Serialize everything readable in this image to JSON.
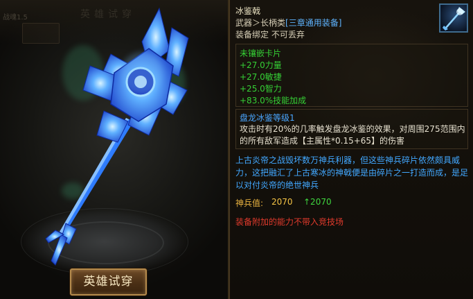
{
  "preview": {
    "ghost_label": "战魂1.5",
    "ghost_title": "英雄试穿",
    "try_button": "英雄试穿"
  },
  "item": {
    "name": "冰鉴戟",
    "type_prefix": "武器＞长柄类",
    "type_tag": "[三章通用装备]",
    "bind": "装备绑定 不可丢弃",
    "icon": "ice-halberd-icon",
    "stats": [
      "未镶嵌卡片",
      "+27.0力量",
      "+27.0敏捷",
      "+25.0智力",
      "+83.0%技能加成"
    ],
    "skill_title": "盘龙冰鉴等级1",
    "skill_desc": "攻击时有20%的几率触发盘龙冰鉴的效果，对周围275范围内的所有敌军造成【主属性*0.15+65】的伤害",
    "lore": "上古炎帝之战毁坏数万神兵利器，但这些神兵碎片依然颇具威力，这把融汇了上古寒冰的神戟便是由碎片之一打造而成，是足以对付炎帝的绝世神兵",
    "power_label": "神兵值:",
    "power_value": "2070",
    "power_up": "↑2070",
    "warning": "装备附加的能力不带入竞技场"
  },
  "colors": {
    "stat_green": "#35d035",
    "skill_blue": "#4aa6ff",
    "lore_blue": "#42a8ff",
    "power_gold": "#e9b340",
    "warning_red": "#e23a2c"
  }
}
